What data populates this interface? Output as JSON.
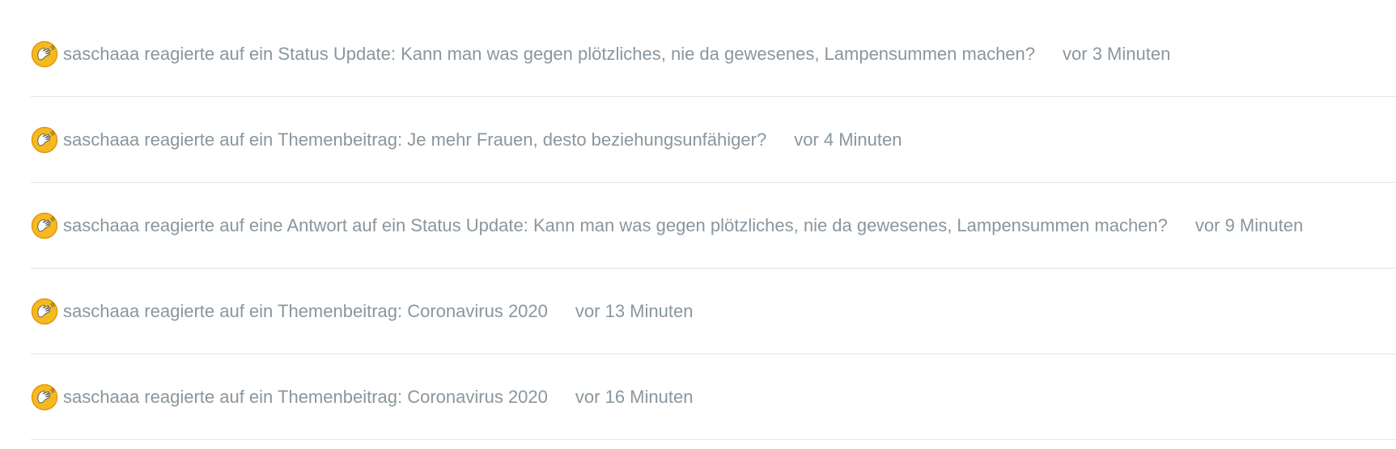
{
  "feed": {
    "items": [
      {
        "icon": "waving-hand-reaction-icon",
        "user": "saschaaa",
        "action": " reagierte auf ein ",
        "target_type": "Status Update",
        "separator": ": ",
        "target_title": "Kann man was gegen plötzliches, nie da gewesenes, Lampensummen machen?",
        "time": "vor 3 Minuten"
      },
      {
        "icon": "waving-hand-reaction-icon",
        "user": "saschaaa",
        "action": " reagierte auf ein ",
        "target_type": "Themenbeitrag",
        "separator": ": ",
        "target_title": "Je mehr Frauen, desto beziehungsunfähiger?",
        "time": "vor 4 Minuten"
      },
      {
        "icon": "waving-hand-reaction-icon",
        "user": "saschaaa",
        "action": " reagierte auf eine ",
        "target_type": "Antwort auf ein Status Update",
        "separator": ": ",
        "target_title": "Kann man was gegen plötzliches, nie da gewesenes, Lampensummen machen?",
        "time": "vor 9 Minuten"
      },
      {
        "icon": "waving-hand-reaction-icon",
        "user": "saschaaa",
        "action": " reagierte auf ein ",
        "target_type": "Themenbeitrag",
        "separator": ": ",
        "target_title": "Coronavirus 2020",
        "time": "vor 13 Minuten"
      },
      {
        "icon": "waving-hand-reaction-icon",
        "user": "saschaaa",
        "action": " reagierte auf ein ",
        "target_type": "Themenbeitrag",
        "separator": ": ",
        "target_title": "Coronavirus 2020",
        "time": "vor 16 Minuten"
      }
    ]
  },
  "colors": {
    "text": "#8a969e",
    "divider": "#e3e5e7",
    "icon_fill": "#f5b921",
    "icon_border": "#e39a0c"
  }
}
